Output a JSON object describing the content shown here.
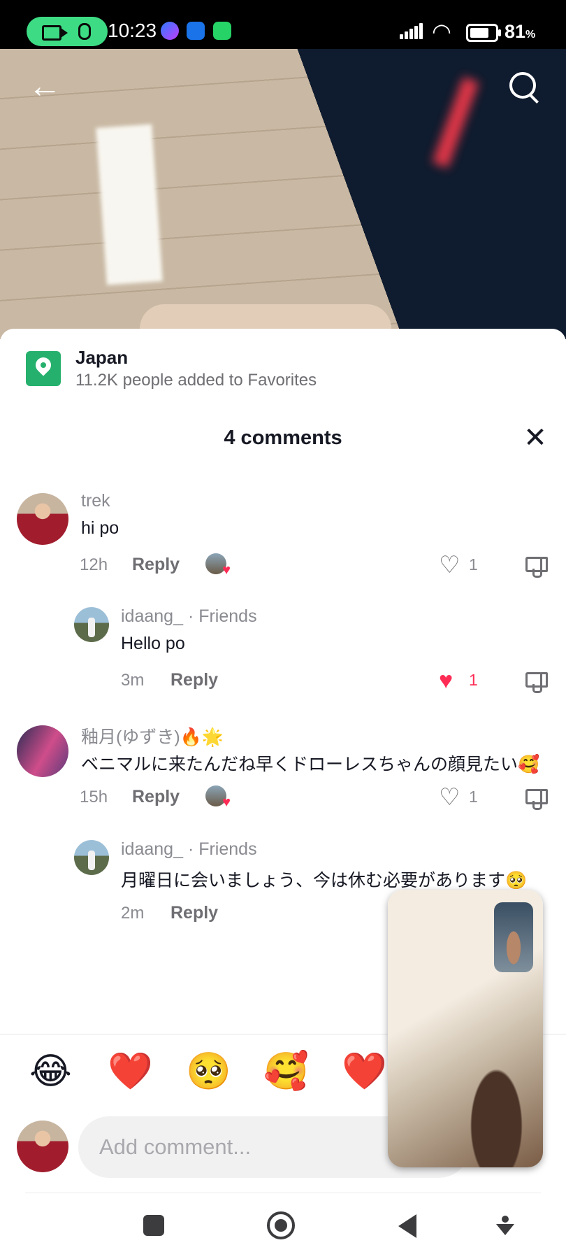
{
  "status_bar": {
    "time": "10:23",
    "battery": "81",
    "battery_unit": "%"
  },
  "location": {
    "name": "Japan",
    "favorites": "11.2K people added to Favorites"
  },
  "comments_header": {
    "title": "4 comments"
  },
  "comments": [
    {
      "user": "trek",
      "text": "hi po",
      "time": "12h",
      "reply": "Reply",
      "likes": "1",
      "liked": false
    },
    {
      "user": "idaang_",
      "tag": "· Friends",
      "text": "Hello po",
      "time": "3m",
      "reply": "Reply",
      "likes": "1",
      "liked": true
    },
    {
      "user": "釉月(ゆずき)🔥🌟",
      "text": "ベニマルに来たんだね早くドローレスちゃんの顔見たい🥰",
      "time": "15h",
      "reply": "Reply",
      "likes": "1",
      "liked": false
    },
    {
      "user": "idaang_",
      "tag": "· Friends",
      "text": "月曜日に会いましょう、今は休む必要があります🥺",
      "time": "2m",
      "reply": "Reply"
    }
  ],
  "quick_emojis": [
    "😂",
    "❤️",
    "🥺",
    "🥰",
    "❤️"
  ],
  "comment_input": {
    "placeholder": "Add comment..."
  },
  "colors": {
    "accent": "#fe2c55",
    "location_green": "#25b06d",
    "call_pill": "#3ddc84"
  }
}
